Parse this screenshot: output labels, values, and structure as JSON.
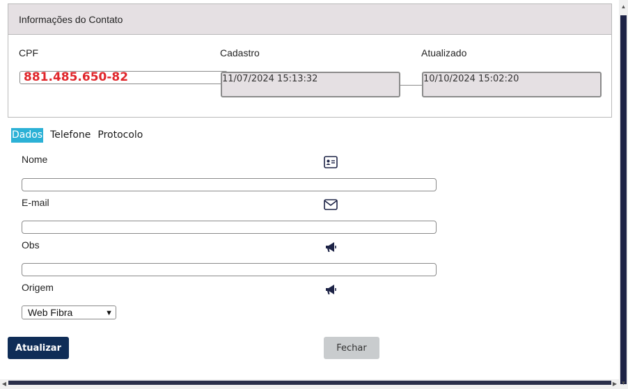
{
  "panel": {
    "title": "Informações do Contato",
    "cpf_label": "CPF",
    "cpf_value": "881.485.650-82",
    "cadastro_label": "Cadastro",
    "cadastro_value": "11/07/2024 15:13:32",
    "atualizado_label": "Atualizado",
    "atualizado_value": "10/10/2024 15:02:20"
  },
  "tabs": [
    {
      "label": "Dados",
      "active": true
    },
    {
      "label": "Telefone",
      "active": false
    },
    {
      "label": "Protocolo",
      "active": false
    }
  ],
  "form": {
    "nome_label": "Nome",
    "nome_value": "",
    "email_label": "E-mail",
    "email_value": "",
    "obs_label": "Obs",
    "obs_value": "",
    "origem_label": "Origem",
    "origem_selected": "Web Fibra"
  },
  "buttons": {
    "atualizar": "Atualizar",
    "fechar": "Fechar"
  },
  "icons": {
    "nome": "id-card-icon",
    "email": "envelope-icon",
    "obs": "megaphone-icon",
    "origem": "megaphone-icon"
  },
  "colors": {
    "cpf_text": "#e0262b",
    "tab_active": "#2bb1d6",
    "primary_button": "#0f2d57",
    "secondary_button": "#c9ccce",
    "header_bg": "#e5e0e3"
  }
}
